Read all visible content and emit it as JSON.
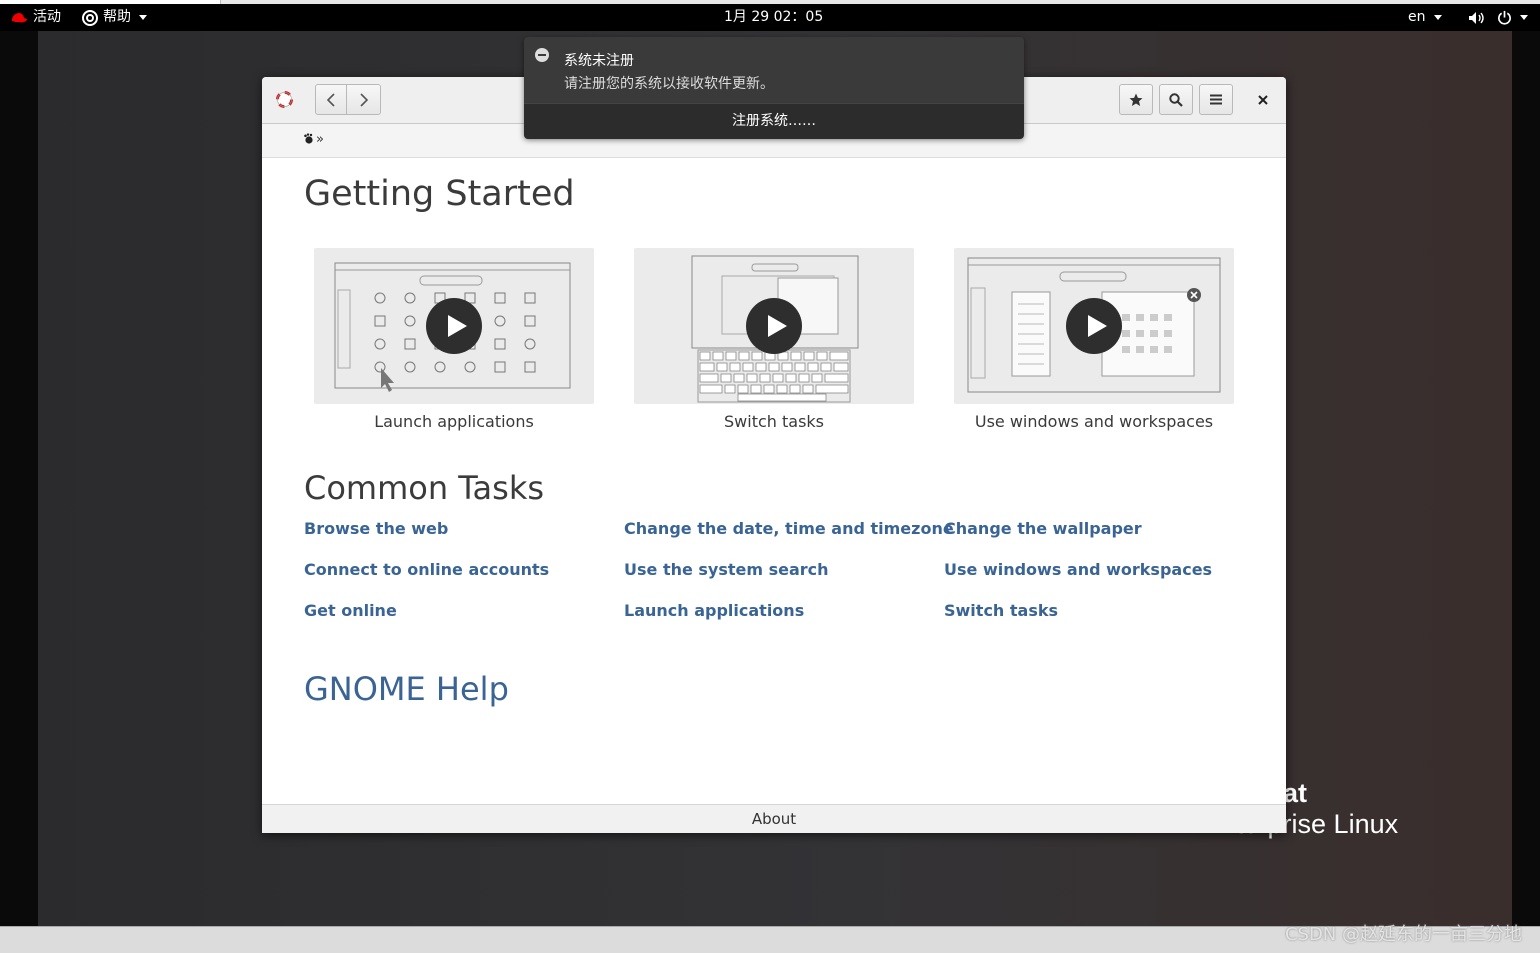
{
  "topbar": {
    "activities": "活动",
    "app_menu": "帮助",
    "clock": "1月 29  02：05",
    "lang": "en"
  },
  "notification": {
    "title": "系统未注册",
    "body": "请注册您的系统以接收软件更新。",
    "action": "注册系统……"
  },
  "window": {
    "breadcrumb_sep": "»",
    "getting_started": {
      "title": "Getting Started",
      "cards": [
        {
          "caption": "Launch applications"
        },
        {
          "caption": "Switch tasks"
        },
        {
          "caption": "Use windows and workspaces"
        }
      ]
    },
    "common_tasks": {
      "title": "Common Tasks",
      "links": [
        [
          "Browse the web",
          "Change the date, time and timezone",
          "Change the wallpaper"
        ],
        [
          "Connect to online accounts",
          "Use the system search",
          "Use windows and workspaces"
        ],
        [
          "Get online",
          "Launch applications",
          "Switch tasks"
        ]
      ]
    },
    "gnome_help": "GNOME Help",
    "footer": "About"
  },
  "desktop": {
    "brand_line1": "at",
    "brand_line2": "Enterprise Linux"
  },
  "watermark": "CSDN @赵延东的一亩三分地",
  "icons": [
    "redhat-icon",
    "help-lifebuoy-icon",
    "back-icon",
    "forward-icon",
    "bookmark-star-icon",
    "search-icon",
    "menu-icon",
    "close-icon",
    "volume-icon",
    "power-icon",
    "play-icon",
    "home-icon"
  ],
  "colors": {
    "link": "#3a6494",
    "topbar": "#000000",
    "notification": "#3a3a3a"
  }
}
